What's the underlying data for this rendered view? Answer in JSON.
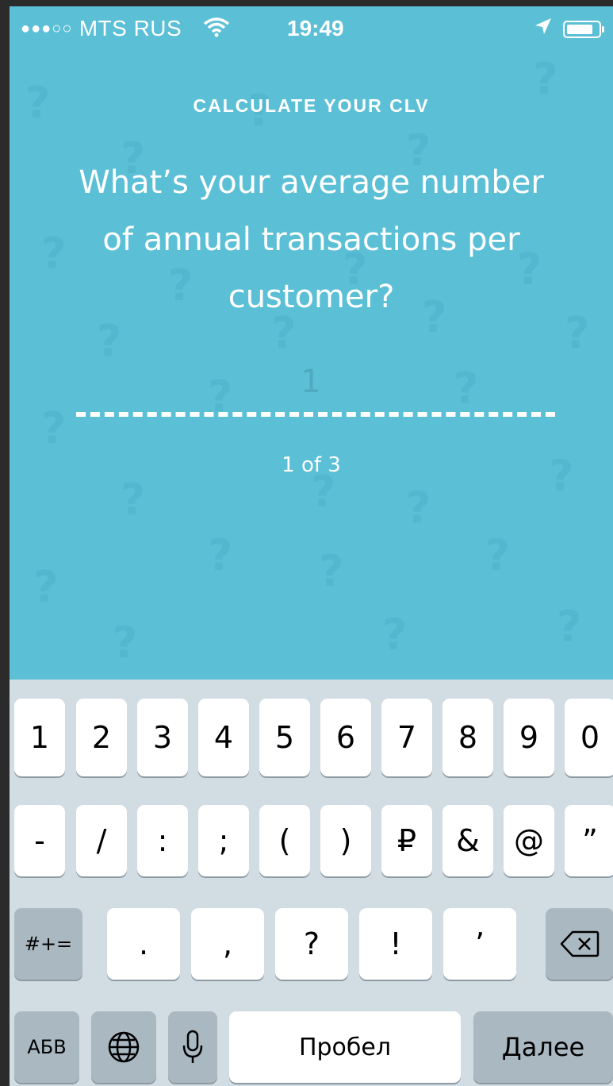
{
  "status_bar": {
    "signal_dots": "●●●○○",
    "carrier": "MTS RUS",
    "time": "19:49",
    "icons": [
      "wifi-icon",
      "location-arrow-icon",
      "battery-icon"
    ]
  },
  "header": {
    "title": "CALCULATE YOUR CLV"
  },
  "question": {
    "line1": "What’s your average number",
    "line2": "of annual transactions per",
    "line3": "customer?"
  },
  "answer": {
    "placeholder": "1"
  },
  "progress": {
    "label": "1 of 3",
    "current": 1,
    "total": 3
  },
  "colors": {
    "background": "#5bbfd6",
    "keyboard": "#d2dce3",
    "accent_text": "#ffffff"
  },
  "keyboard": {
    "row1": [
      "1",
      "2",
      "3",
      "4",
      "5",
      "6",
      "7",
      "8",
      "9",
      "0"
    ],
    "row2": [
      "-",
      "/",
      ":",
      ";",
      "(",
      ")",
      "₽",
      "&",
      "@",
      "”"
    ],
    "row3": {
      "symbols_key": "#+=",
      "keys": [
        ".",
        ",",
        "?",
        "!",
        "’"
      ],
      "delete_icon": "backspace-icon"
    },
    "row4": {
      "alpha_key": "АБВ",
      "globe_icon": "globe-icon",
      "mic_icon": "microphone-icon",
      "space": "Пробел",
      "return": "Далее"
    }
  }
}
